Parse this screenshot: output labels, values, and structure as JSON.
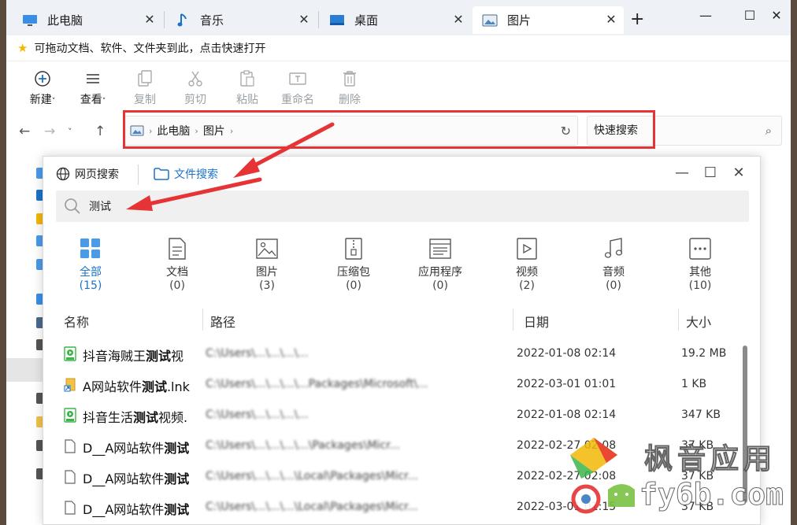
{
  "tabs": [
    {
      "label": "此电脑",
      "icon": "computer-icon"
    },
    {
      "label": "音乐",
      "icon": "music-icon"
    },
    {
      "label": "桌面",
      "icon": "desktop-icon"
    },
    {
      "label": "图片",
      "icon": "pictures-icon",
      "active": true
    }
  ],
  "notice": {
    "text": "可拖动文档、软件、文件夹到此，点击快速打开"
  },
  "toolbar": {
    "new_label": "新建",
    "view_label": "查看",
    "copy_label": "复制",
    "cut_label": "剪切",
    "paste_label": "粘贴",
    "rename_label": "重命名",
    "delete_label": "删除"
  },
  "address": {
    "crumbs": [
      "此电脑",
      "图片"
    ]
  },
  "search": {
    "quick_label": "快速搜索"
  },
  "popup": {
    "tab_web": "网页搜索",
    "tab_file": "文件搜索",
    "query": "测试",
    "categories": [
      {
        "label": "全部",
        "count": "(15)",
        "icon": "grid-icon"
      },
      {
        "label": "文档",
        "count": "(0)",
        "icon": "document-icon"
      },
      {
        "label": "图片",
        "count": "(3)",
        "icon": "image-icon"
      },
      {
        "label": "压缩包",
        "count": "(0)",
        "icon": "archive-icon"
      },
      {
        "label": "应用程序",
        "count": "(0)",
        "icon": "application-icon"
      },
      {
        "label": "视频",
        "count": "(2)",
        "icon": "video-icon"
      },
      {
        "label": "音频",
        "count": "(0)",
        "icon": "audio-icon"
      },
      {
        "label": "其他",
        "count": "(10)",
        "icon": "other-icon"
      }
    ],
    "columns": {
      "name": "名称",
      "path": "路径",
      "date": "日期",
      "size": "大小"
    },
    "rows": [
      {
        "pre": "抖音海贼王",
        "hl": "测试",
        "post": "视",
        "path": "C:\\Users\\...\\...\\...\\...",
        "date": "2022-01-08 02:14",
        "size": "19.2 MB",
        "icon": "video-file-icon"
      },
      {
        "pre": "A网站软件",
        "hl": "测试",
        "post": ".lnk",
        "path": "C:\\Users\\...\\...\\...\\...Packages\\Microsoft\\...",
        "date": "2022-03-01 01:01",
        "size": "1 KB",
        "icon": "shortcut-file-icon"
      },
      {
        "pre": "抖音生活",
        "hl": "测试",
        "post": "视频.",
        "path": "C:\\Users\\...\\...\\...\\...",
        "date": "2022-01-08 02:14",
        "size": "347 KB",
        "icon": "video-file-icon"
      },
      {
        "pre": "D__A网站软件",
        "hl": "测试",
        "post": "",
        "path": "C:\\Users\\...\\...\\...\\...\\Packages\\Micr...",
        "date": "2022-02-27 02:08",
        "size": "37 KB",
        "icon": "blank-file-icon"
      },
      {
        "pre": "D__A网站软件",
        "hl": "测试",
        "post": "",
        "path": "C:\\Users\\...\\...\\...\\Local\\Packages\\Micr...",
        "date": "2022-02-27 02:08",
        "size": "37 KB",
        "icon": "blank-file-icon"
      },
      {
        "pre": "D__A网站软件",
        "hl": "测试",
        "post": "",
        "path": "C:\\Users\\...\\...\\...\\Local\\Packages\\Micr...",
        "date": "2022-03-01 01:15",
        "size": "37 KB",
        "icon": "blank-file-icon"
      }
    ]
  },
  "watermark": {
    "line1": "枫音应用",
    "line2": "fy6b.com"
  },
  "colors": {
    "accent": "#1a73c9",
    "annotation_red": "#e63436",
    "file_green": "#3bb54a"
  }
}
